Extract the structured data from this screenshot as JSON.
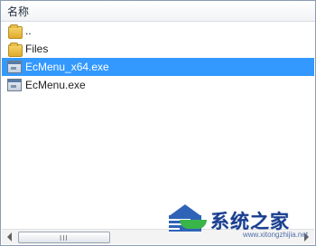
{
  "header": {
    "column_name": "名称"
  },
  "files": [
    {
      "name": "..",
      "type": "folder",
      "selected": false
    },
    {
      "name": "Files",
      "type": "folder",
      "selected": false
    },
    {
      "name": "EcMenu_x64.exe",
      "type": "exe",
      "selected": true
    },
    {
      "name": "EcMenu.exe",
      "type": "exe",
      "selected": false
    }
  ],
  "scrollbar": {
    "thumb_grip": "III"
  },
  "watermark": {
    "brand": "系统之家",
    "url": "www.xitongzhijia.net"
  },
  "colors": {
    "selection": "#3399ff",
    "watermark_blue": "#2f63b7",
    "watermark_green": "#39b54a"
  }
}
